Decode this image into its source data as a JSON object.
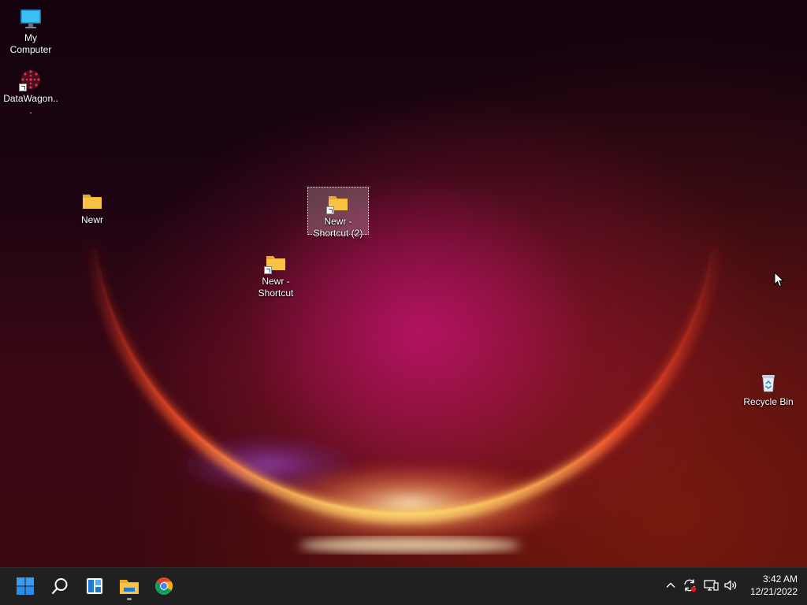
{
  "desktop": {
    "icons": [
      {
        "label": "My Computer",
        "type": "computer"
      },
      {
        "label": "DataWagon...",
        "type": "app-shortcut"
      },
      {
        "label": "Newr",
        "type": "folder"
      },
      {
        "label": "Newr - Shortcut (2)",
        "type": "folder-shortcut",
        "selected": true
      },
      {
        "label": "Newr - Shortcut",
        "type": "folder-shortcut"
      },
      {
        "label": "Recycle Bin",
        "type": "recycle-bin"
      }
    ]
  },
  "taskbar": {
    "pinned": [
      {
        "name": "start-button",
        "icon": "windows-logo-icon"
      },
      {
        "name": "search-button",
        "icon": "search-icon"
      },
      {
        "name": "widgets-button",
        "icon": "widgets-icon"
      },
      {
        "name": "file-explorer-button",
        "icon": "file-explorer-icon",
        "running": true
      },
      {
        "name": "chrome-button",
        "icon": "chrome-icon"
      }
    ],
    "tray": [
      "chevron-up-icon",
      "sync-icon",
      "network-icon",
      "volume-icon"
    ],
    "clock": {
      "time": "3:42 AM",
      "date": "12/21/2022"
    }
  },
  "colors": {
    "taskbar_bg": "#202020",
    "accent_blue": "#0078d4",
    "folder_yellow": "#f8c244"
  }
}
